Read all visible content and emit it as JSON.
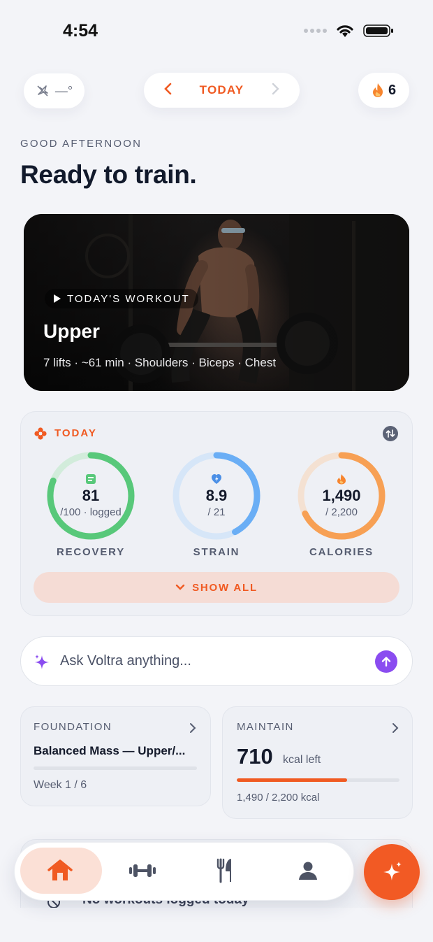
{
  "status_bar": {
    "time": "4:54"
  },
  "header": {
    "weather_text": "—°",
    "date_label": "TODAY",
    "streak_count": "6"
  },
  "greeting": "GOOD AFTERNOON",
  "headline": "Ready to train.",
  "workout": {
    "badge": "TODAY'S WORKOUT",
    "title": "Upper",
    "meta": "7 lifts · ~61 min · Shoulders · Biceps · Chest"
  },
  "today": {
    "title": "TODAY",
    "rings": [
      {
        "label": "RECOVERY",
        "value": "81",
        "sub": "/100 · logged",
        "progress": 0.81,
        "color": "#58c87a",
        "track": "#d2ecdb",
        "icon": "clipboard-icon"
      },
      {
        "label": "STRAIN",
        "value": "8.9",
        "sub": "/ 21",
        "progress": 0.424,
        "color": "#6aaef5",
        "track": "#d6e6f8",
        "icon": "heart-bolt-icon"
      },
      {
        "label": "CALORIES",
        "value": "1,490",
        "sub": "/ 2,200",
        "progress": 0.677,
        "color": "#f7a054",
        "track": "#f4e1d2",
        "icon": "flame-icon"
      }
    ],
    "show_all": "SHOW ALL"
  },
  "ask": {
    "placeholder": "Ask Voltra anything..."
  },
  "plan_card": {
    "heading": "FOUNDATION",
    "name": "Balanced Mass — Upper/...",
    "week": "Week 1 / 6",
    "progress": 0
  },
  "nutrition_card": {
    "heading": "MAINTAIN",
    "kcal_left": "710",
    "kcal_unit": "kcal left",
    "detail": "1,490 / 2,200 kcal",
    "progress": 0.677
  },
  "peek": {
    "text": "No workouts logged today"
  },
  "nav": {
    "items": [
      "home-icon",
      "dumbbell-icon",
      "fork-knife-icon",
      "profile-icon"
    ],
    "fab_icon": "sparkle-icon"
  },
  "colors": {
    "accent": "#f05a22",
    "ai_purple": "#8a4cf0"
  }
}
